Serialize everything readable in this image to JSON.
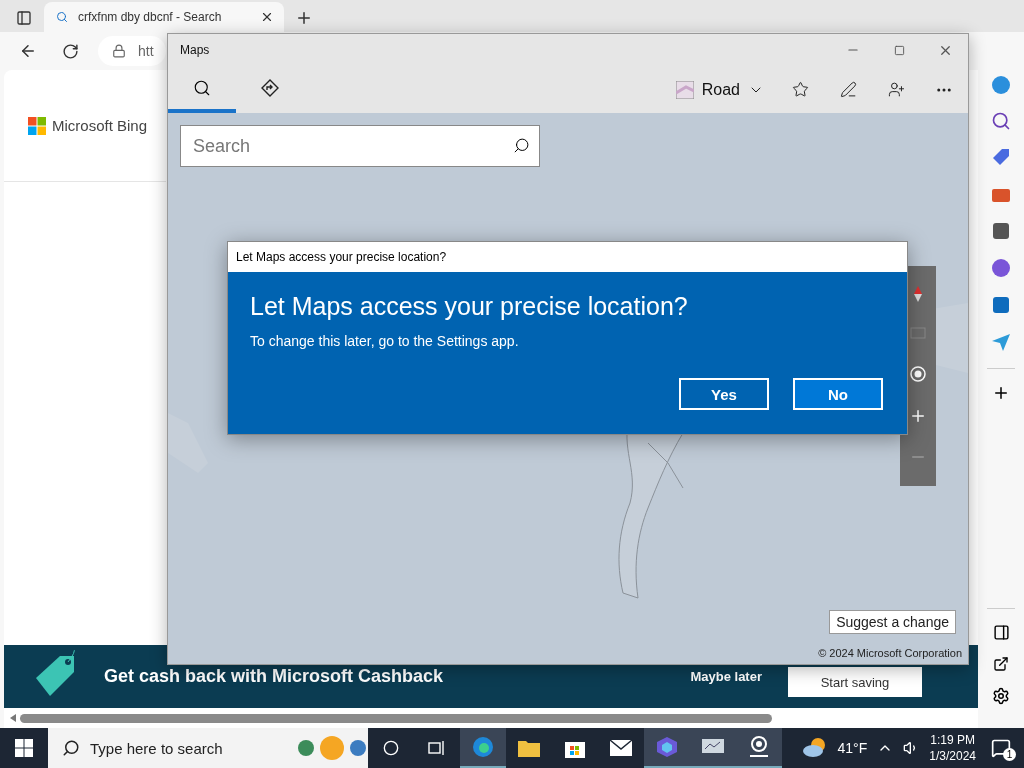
{
  "browser": {
    "tab_title": "crfxfnm dby dbcnf - Search",
    "address": "htt",
    "logo_text": "Microsoft Bing",
    "banner": {
      "text": "Get cash back with Microsoft Cashback",
      "dismiss": "Maybe later",
      "action": "Start saving"
    }
  },
  "maps": {
    "title": "Maps",
    "tabs": [
      {
        "kind": "search",
        "selected": true
      },
      {
        "kind": "directions",
        "selected": false
      }
    ],
    "map_style": "Road",
    "search": {
      "placeholder": "Search"
    },
    "suggest": "Suggest a change",
    "copyright": "© 2024 Microsoft Corporation"
  },
  "dialog": {
    "title": "Let Maps access your precise location?",
    "heading": "Let Maps access your precise location?",
    "body": "To change this later, go to the Settings app.",
    "buttons": [
      {
        "label": "Yes",
        "selected": false
      },
      {
        "label": "No",
        "selected": true
      }
    ]
  },
  "taskbar": {
    "search_placeholder": "Type here to search",
    "temperature": "41°F",
    "time": "1:19 PM",
    "date": "1/3/2024",
    "notification_count": "1"
  }
}
